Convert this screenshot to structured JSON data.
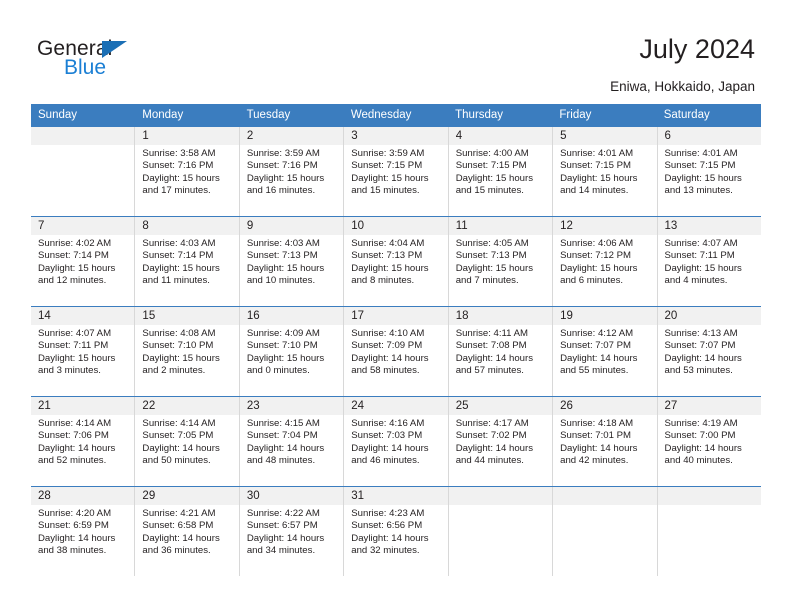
{
  "brand": {
    "name_top": "General",
    "name_bottom": "Blue",
    "triangle_color": "#1b6fb5",
    "blue_color": "#1b7fd4"
  },
  "header": {
    "title": "July 2024",
    "location": "Eniwa, Hokkaido, Japan",
    "header_bg": "#3b7dbf",
    "header_text_color": "#ffffff"
  },
  "calendar": {
    "weekdays": [
      "Sunday",
      "Monday",
      "Tuesday",
      "Wednesday",
      "Thursday",
      "Friday",
      "Saturday"
    ],
    "weeks": [
      [
        {
          "day": "",
          "sunrise": "",
          "sunset": "",
          "daylight1": "",
          "daylight2": ""
        },
        {
          "day": "1",
          "sunrise": "Sunrise: 3:58 AM",
          "sunset": "Sunset: 7:16 PM",
          "daylight1": "Daylight: 15 hours",
          "daylight2": "and 17 minutes."
        },
        {
          "day": "2",
          "sunrise": "Sunrise: 3:59 AM",
          "sunset": "Sunset: 7:16 PM",
          "daylight1": "Daylight: 15 hours",
          "daylight2": "and 16 minutes."
        },
        {
          "day": "3",
          "sunrise": "Sunrise: 3:59 AM",
          "sunset": "Sunset: 7:15 PM",
          "daylight1": "Daylight: 15 hours",
          "daylight2": "and 15 minutes."
        },
        {
          "day": "4",
          "sunrise": "Sunrise: 4:00 AM",
          "sunset": "Sunset: 7:15 PM",
          "daylight1": "Daylight: 15 hours",
          "daylight2": "and 15 minutes."
        },
        {
          "day": "5",
          "sunrise": "Sunrise: 4:01 AM",
          "sunset": "Sunset: 7:15 PM",
          "daylight1": "Daylight: 15 hours",
          "daylight2": "and 14 minutes."
        },
        {
          "day": "6",
          "sunrise": "Sunrise: 4:01 AM",
          "sunset": "Sunset: 7:15 PM",
          "daylight1": "Daylight: 15 hours",
          "daylight2": "and 13 minutes."
        }
      ],
      [
        {
          "day": "7",
          "sunrise": "Sunrise: 4:02 AM",
          "sunset": "Sunset: 7:14 PM",
          "daylight1": "Daylight: 15 hours",
          "daylight2": "and 12 minutes."
        },
        {
          "day": "8",
          "sunrise": "Sunrise: 4:03 AM",
          "sunset": "Sunset: 7:14 PM",
          "daylight1": "Daylight: 15 hours",
          "daylight2": "and 11 minutes."
        },
        {
          "day": "9",
          "sunrise": "Sunrise: 4:03 AM",
          "sunset": "Sunset: 7:13 PM",
          "daylight1": "Daylight: 15 hours",
          "daylight2": "and 10 minutes."
        },
        {
          "day": "10",
          "sunrise": "Sunrise: 4:04 AM",
          "sunset": "Sunset: 7:13 PM",
          "daylight1": "Daylight: 15 hours",
          "daylight2": "and 8 minutes."
        },
        {
          "day": "11",
          "sunrise": "Sunrise: 4:05 AM",
          "sunset": "Sunset: 7:13 PM",
          "daylight1": "Daylight: 15 hours",
          "daylight2": "and 7 minutes."
        },
        {
          "day": "12",
          "sunrise": "Sunrise: 4:06 AM",
          "sunset": "Sunset: 7:12 PM",
          "daylight1": "Daylight: 15 hours",
          "daylight2": "and 6 minutes."
        },
        {
          "day": "13",
          "sunrise": "Sunrise: 4:07 AM",
          "sunset": "Sunset: 7:11 PM",
          "daylight1": "Daylight: 15 hours",
          "daylight2": "and 4 minutes."
        }
      ],
      [
        {
          "day": "14",
          "sunrise": "Sunrise: 4:07 AM",
          "sunset": "Sunset: 7:11 PM",
          "daylight1": "Daylight: 15 hours",
          "daylight2": "and 3 minutes."
        },
        {
          "day": "15",
          "sunrise": "Sunrise: 4:08 AM",
          "sunset": "Sunset: 7:10 PM",
          "daylight1": "Daylight: 15 hours",
          "daylight2": "and 2 minutes."
        },
        {
          "day": "16",
          "sunrise": "Sunrise: 4:09 AM",
          "sunset": "Sunset: 7:10 PM",
          "daylight1": "Daylight: 15 hours",
          "daylight2": "and 0 minutes."
        },
        {
          "day": "17",
          "sunrise": "Sunrise: 4:10 AM",
          "sunset": "Sunset: 7:09 PM",
          "daylight1": "Daylight: 14 hours",
          "daylight2": "and 58 minutes."
        },
        {
          "day": "18",
          "sunrise": "Sunrise: 4:11 AM",
          "sunset": "Sunset: 7:08 PM",
          "daylight1": "Daylight: 14 hours",
          "daylight2": "and 57 minutes."
        },
        {
          "day": "19",
          "sunrise": "Sunrise: 4:12 AM",
          "sunset": "Sunset: 7:07 PM",
          "daylight1": "Daylight: 14 hours",
          "daylight2": "and 55 minutes."
        },
        {
          "day": "20",
          "sunrise": "Sunrise: 4:13 AM",
          "sunset": "Sunset: 7:07 PM",
          "daylight1": "Daylight: 14 hours",
          "daylight2": "and 53 minutes."
        }
      ],
      [
        {
          "day": "21",
          "sunrise": "Sunrise: 4:14 AM",
          "sunset": "Sunset: 7:06 PM",
          "daylight1": "Daylight: 14 hours",
          "daylight2": "and 52 minutes."
        },
        {
          "day": "22",
          "sunrise": "Sunrise: 4:14 AM",
          "sunset": "Sunset: 7:05 PM",
          "daylight1": "Daylight: 14 hours",
          "daylight2": "and 50 minutes."
        },
        {
          "day": "23",
          "sunrise": "Sunrise: 4:15 AM",
          "sunset": "Sunset: 7:04 PM",
          "daylight1": "Daylight: 14 hours",
          "daylight2": "and 48 minutes."
        },
        {
          "day": "24",
          "sunrise": "Sunrise: 4:16 AM",
          "sunset": "Sunset: 7:03 PM",
          "daylight1": "Daylight: 14 hours",
          "daylight2": "and 46 minutes."
        },
        {
          "day": "25",
          "sunrise": "Sunrise: 4:17 AM",
          "sunset": "Sunset: 7:02 PM",
          "daylight1": "Daylight: 14 hours",
          "daylight2": "and 44 minutes."
        },
        {
          "day": "26",
          "sunrise": "Sunrise: 4:18 AM",
          "sunset": "Sunset: 7:01 PM",
          "daylight1": "Daylight: 14 hours",
          "daylight2": "and 42 minutes."
        },
        {
          "day": "27",
          "sunrise": "Sunrise: 4:19 AM",
          "sunset": "Sunset: 7:00 PM",
          "daylight1": "Daylight: 14 hours",
          "daylight2": "and 40 minutes."
        }
      ],
      [
        {
          "day": "28",
          "sunrise": "Sunrise: 4:20 AM",
          "sunset": "Sunset: 6:59 PM",
          "daylight1": "Daylight: 14 hours",
          "daylight2": "and 38 minutes."
        },
        {
          "day": "29",
          "sunrise": "Sunrise: 4:21 AM",
          "sunset": "Sunset: 6:58 PM",
          "daylight1": "Daylight: 14 hours",
          "daylight2": "and 36 minutes."
        },
        {
          "day": "30",
          "sunrise": "Sunrise: 4:22 AM",
          "sunset": "Sunset: 6:57 PM",
          "daylight1": "Daylight: 14 hours",
          "daylight2": "and 34 minutes."
        },
        {
          "day": "31",
          "sunrise": "Sunrise: 4:23 AM",
          "sunset": "Sunset: 6:56 PM",
          "daylight1": "Daylight: 14 hours",
          "daylight2": "and 32 minutes."
        },
        {
          "day": "",
          "sunrise": "",
          "sunset": "",
          "daylight1": "",
          "daylight2": ""
        },
        {
          "day": "",
          "sunrise": "",
          "sunset": "",
          "daylight1": "",
          "daylight2": ""
        },
        {
          "day": "",
          "sunrise": "",
          "sunset": "",
          "daylight1": "",
          "daylight2": ""
        }
      ]
    ]
  }
}
